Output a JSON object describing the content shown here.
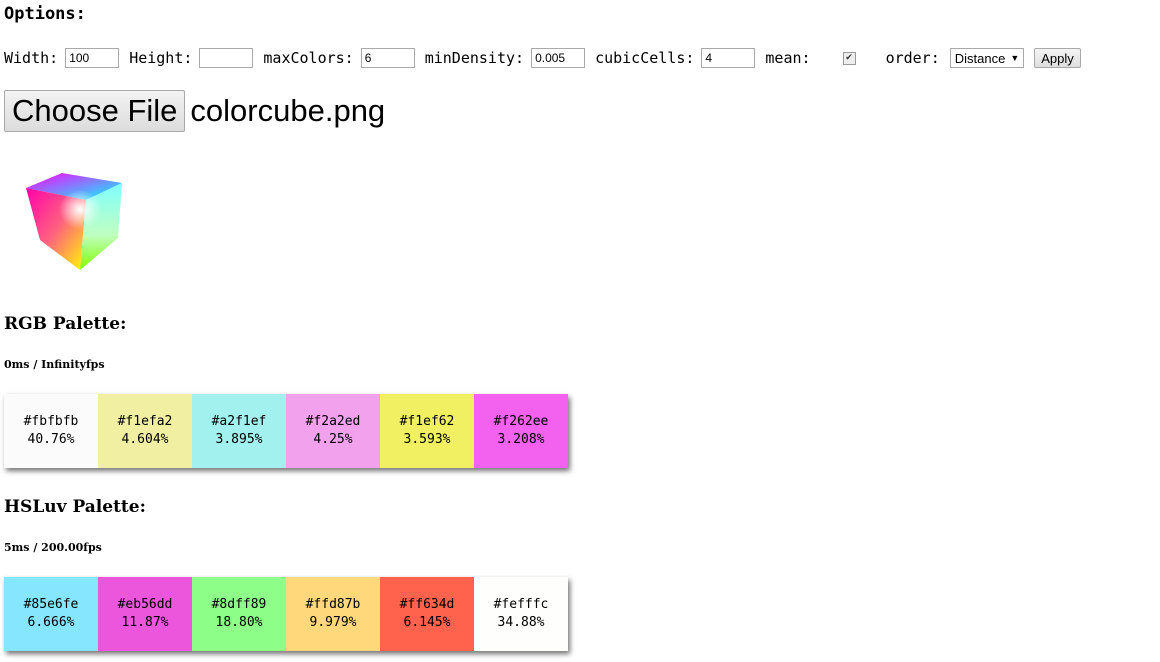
{
  "options": {
    "title": "Options:",
    "width_label": "Width:",
    "width_value": "100",
    "height_label": "Height:",
    "height_value": "",
    "maxcolors_label": "maxColors:",
    "maxcolors_value": "6",
    "mindensity_label": "minDensity:",
    "mindensity_value": "0.005",
    "cubiccells_label": "cubicCells:",
    "cubiccells_value": "4",
    "mean_label": "mean:",
    "mean_checked": true,
    "order_label": "order:",
    "order_value": "Distance",
    "apply_label": "Apply"
  },
  "file": {
    "button_label": "Choose File",
    "filename": "colorcube.png"
  },
  "rgb": {
    "title": "RGB Palette:",
    "timing": "0ms / Infinityfps",
    "swatches": [
      {
        "hex": "#fbfbfb",
        "pct": "40.76%"
      },
      {
        "hex": "#f1efa2",
        "pct": "4.604%"
      },
      {
        "hex": "#a2f1ef",
        "pct": "3.895%"
      },
      {
        "hex": "#f2a2ed",
        "pct": "4.25%"
      },
      {
        "hex": "#f1ef62",
        "pct": "3.593%"
      },
      {
        "hex": "#f262ee",
        "pct": "3.208%"
      }
    ]
  },
  "hsluv": {
    "title": "HSLuv Palette:",
    "timing": "5ms / 200.00fps",
    "swatches": [
      {
        "hex": "#85e6fe",
        "pct": "6.666%"
      },
      {
        "hex": "#eb56dd",
        "pct": "11.87%"
      },
      {
        "hex": "#8dff89",
        "pct": "18.80%"
      },
      {
        "hex": "#ffd87b",
        "pct": "9.979%"
      },
      {
        "hex": "#ff634d",
        "pct": "6.145%"
      },
      {
        "hex": "#fefffc",
        "pct": "34.88%"
      }
    ]
  }
}
